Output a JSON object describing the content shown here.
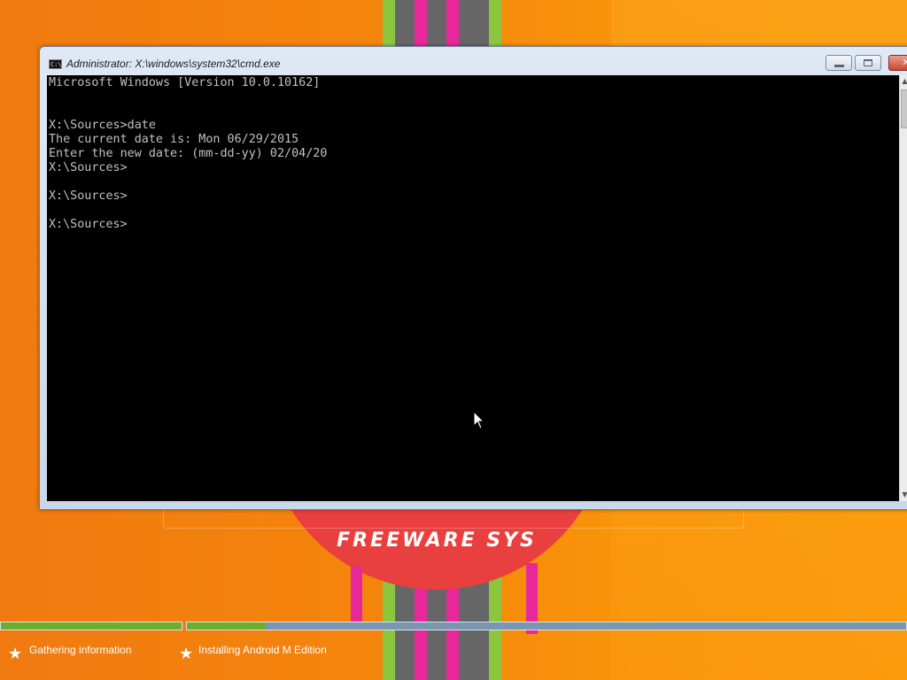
{
  "window": {
    "title": "Administrator: X:\\windows\\system32\\cmd.exe",
    "icon_text": "C:\\",
    "buttons": {
      "minimize": "minimize",
      "maximize": "maximize",
      "close": "✕"
    }
  },
  "console": {
    "lines": [
      "Microsoft Windows [Version 10.0.10162]",
      "",
      "",
      "X:\\Sources>date",
      "The current date is: Mon 06/29/2015",
      "Enter the new date: (mm-dd-yy) 02/04/20",
      "X:\\Sources>",
      "",
      "X:\\Sources>",
      "",
      "X:\\Sources>"
    ]
  },
  "background": {
    "brand_text": "FREEWARE SYS"
  },
  "installer": {
    "steps": [
      {
        "label": "Gathering information",
        "icon": "star-icon",
        "progress": 1.0
      },
      {
        "label": "Installing Android M Edition",
        "icon": "star-icon",
        "progress": 0.11
      }
    ]
  },
  "colors": {
    "console_bg": "#000000",
    "console_fg": "#c0c0c0",
    "progress_green": "#6fad2e",
    "progress_track": "#7a96b0",
    "disc_red": "#e8403e",
    "stripe_green": "#8cc63f",
    "stripe_gray": "#666666",
    "stripe_pink": "#e8279a"
  }
}
